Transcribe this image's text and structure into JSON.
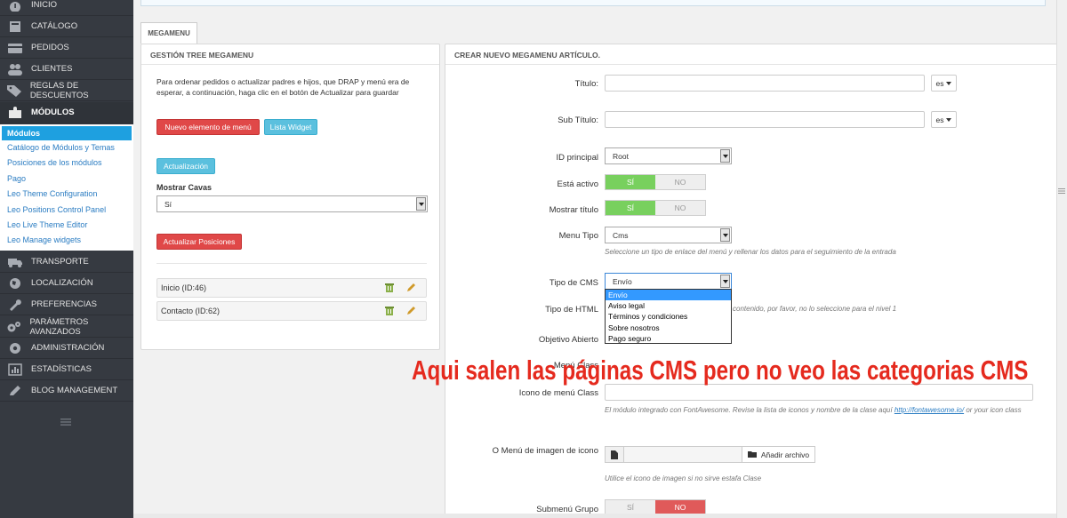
{
  "sidebar": {
    "items": [
      {
        "label": "Inicio",
        "icon": "dashboard-icon"
      },
      {
        "label": "Catálogo",
        "icon": "book-icon"
      },
      {
        "label": "Pedidos",
        "icon": "credit-card-icon"
      },
      {
        "label": "Clientes",
        "icon": "users-icon"
      },
      {
        "label": "Reglas de descuentos",
        "icon": "tag-icon"
      },
      {
        "label": "Módulos",
        "icon": "puzzle-icon"
      },
      {
        "label": "Transporte",
        "icon": "truck-icon"
      },
      {
        "label": "Localización",
        "icon": "globe-icon"
      },
      {
        "label": "Preferencias",
        "icon": "wrench-icon"
      },
      {
        "label": "Parámetros avanzados",
        "icon": "cogs-icon"
      },
      {
        "label": "Administración",
        "icon": "gear-icon"
      },
      {
        "label": "Estadísticas",
        "icon": "bar-chart-icon"
      },
      {
        "label": "Blog Management",
        "icon": "pencil-icon"
      }
    ],
    "submenu": [
      "Módulos",
      "Catálogo de Módulos y Temas",
      "Posiciones de los módulos",
      "Pago",
      "Leo Theme Configuration",
      "Leo Positions Control Panel",
      "Leo Live Theme Editor",
      "Leo Manage widgets"
    ]
  },
  "tab": {
    "label": "MEGAMENU"
  },
  "left_panel": {
    "title": "GESTIÓN TREE MEGAMENU",
    "description": "Para ordenar pedidos o actualizar padres e hijos, que DRAP y menú era de esperar, a continuación, haga clic en el botón de Actualizar para guardar",
    "new_item_button": "Nuevo elemento de menú",
    "widget_list_button": "Lista Widget",
    "update_button": "Actualización",
    "show_label": "Mostrar Cavas",
    "show_value": "Sí",
    "update_positions_button": "Actualizar Posiciones",
    "tree_items": [
      "Inicio (ID:46)",
      "Contacto (ID:62)"
    ]
  },
  "right_panel": {
    "title": "CREAR NUEVO MEGAMENU ARTÍCULO.",
    "title_label": "Título:",
    "subtitle_label": "Sub Título:",
    "lang": "es",
    "parent_label": "ID principal",
    "parent_value": "Root",
    "active_label": "Está activo",
    "show_title_label": "Mostrar título",
    "yes": "SÍ",
    "no": "NO",
    "menu_type_label": "Menu Tipo",
    "menu_type_value": "Cms",
    "menu_type_help": "Seleccione un tipo de enlace del menú y rellenar los datos para el seguimiento de la entrada",
    "cms_type_label": "Tipo de CMS",
    "cms_type_value": "Envío",
    "cms_options": [
      "Envío",
      "Aviso legal",
      "Términos y condiciones",
      "Sobre nosotros",
      "Pago seguro"
    ],
    "html_type_label": "Tipo de HTML",
    "html_help": "contenido, por favor, no lo seleccione para el nivel 1",
    "target_label": "Objetivo Abierto",
    "menu_class_label": "Menú Class",
    "icon_class_label": "Icono de menú Class",
    "icon_help_1": "El módulo integrado con FontAwesome. Revise la lista de iconos y nombre de la clase aquí",
    "icon_help_link": "http://fontawesome.io/",
    "icon_help_2": "or your icon class",
    "image_icon_label": "O Menú de imagen de icono",
    "add_file_button": "Añadir archivo",
    "image_help": "Utilice el icono de imagen si no sirve estafa Clase",
    "submenu_group_label": "Submenú Grupo"
  },
  "annotation": "Aqui salen las páginas CMS pero no veo las categorias CMS",
  "colors": {
    "sidebar_bg": "#363a41",
    "active_sub": "#1ea0e0",
    "danger": "#e04848",
    "info": "#5bc0de",
    "success": "#78d05e",
    "annotation": "#e52a1e"
  }
}
